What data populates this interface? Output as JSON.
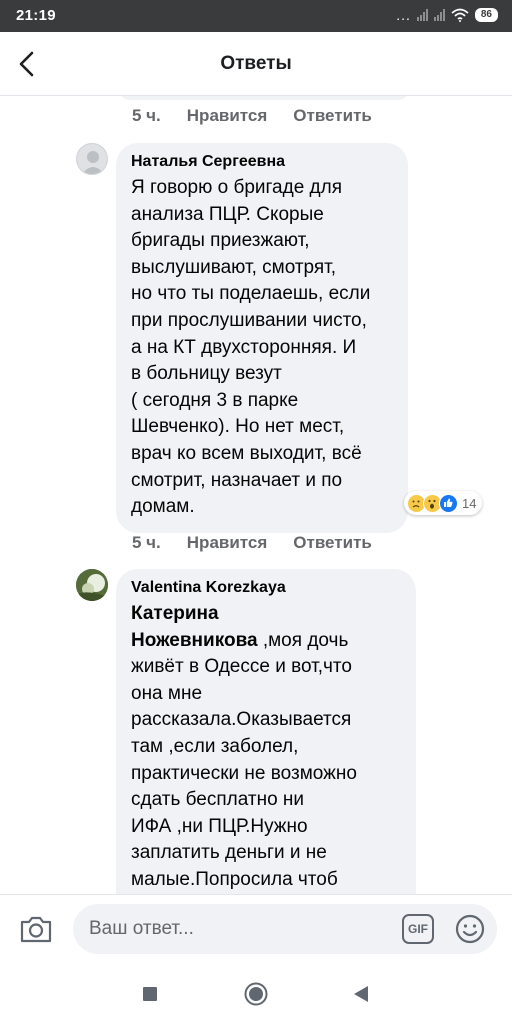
{
  "status_bar": {
    "time": "21:19",
    "dots": "...",
    "battery": "86",
    "icons": [
      "signal-icon",
      "signal-icon",
      "wifi-icon",
      "battery-icon"
    ]
  },
  "header": {
    "title": "Ответы",
    "back_icon": "back-arrow-icon"
  },
  "previous_comment": {
    "time": "5 ч.",
    "like_label": "Нравится",
    "reply_label": "Ответить"
  },
  "comments": [
    {
      "author": "Наталья Сергеевна",
      "text": "Я говорю о бригаде для\nанализа ПЦР. Скорые\nбригады приезжают,\nвыслушивают, смотрят,\nно что ты поделаешь, если\nпри прослушивании чисто,\nа на КТ двухсторонняя. И\nв больницу везут\n( сегодня 3 в парке\nШевченко). Но нет мест,\nврач ко всем выходит, всё\nсмотрит, назначает и по\nдомам.",
      "reactions": {
        "icons": [
          "sad-emoji-icon",
          "wow-emoji-icon",
          "like-icon"
        ],
        "count": "14"
      },
      "time": "5 ч.",
      "like_label": "Нравится",
      "reply_label": "Ответить"
    },
    {
      "author": "Valentina Korezkaya",
      "mention": "Катерина\nНожевникова",
      "text": " ,моя дочь\nживёт в Одессе и вот,что\nона мне\nрассказала.Оказывается\nтам ,если заболел,\nпрактически не возможно\nсдать бесплатно ни\nИФА ,ни ПЦР.Нужно\nзаплатить деньги и не\nмалые.Попросила чтоб"
    }
  ],
  "input_bar": {
    "placeholder": "Ваш ответ...",
    "gif_label": "GIF",
    "camera_icon": "camera-icon",
    "emoji_icon": "smiley-icon"
  },
  "nav_bar": {
    "icons": [
      "recent-apps-square-icon",
      "home-circle-icon",
      "back-triangle-icon"
    ]
  },
  "colors": {
    "status_bar_bg": "#3a3b3c",
    "bubble_bg": "#f0f2f5",
    "secondary_text": "#65676b",
    "like_blue": "#1877f2"
  }
}
